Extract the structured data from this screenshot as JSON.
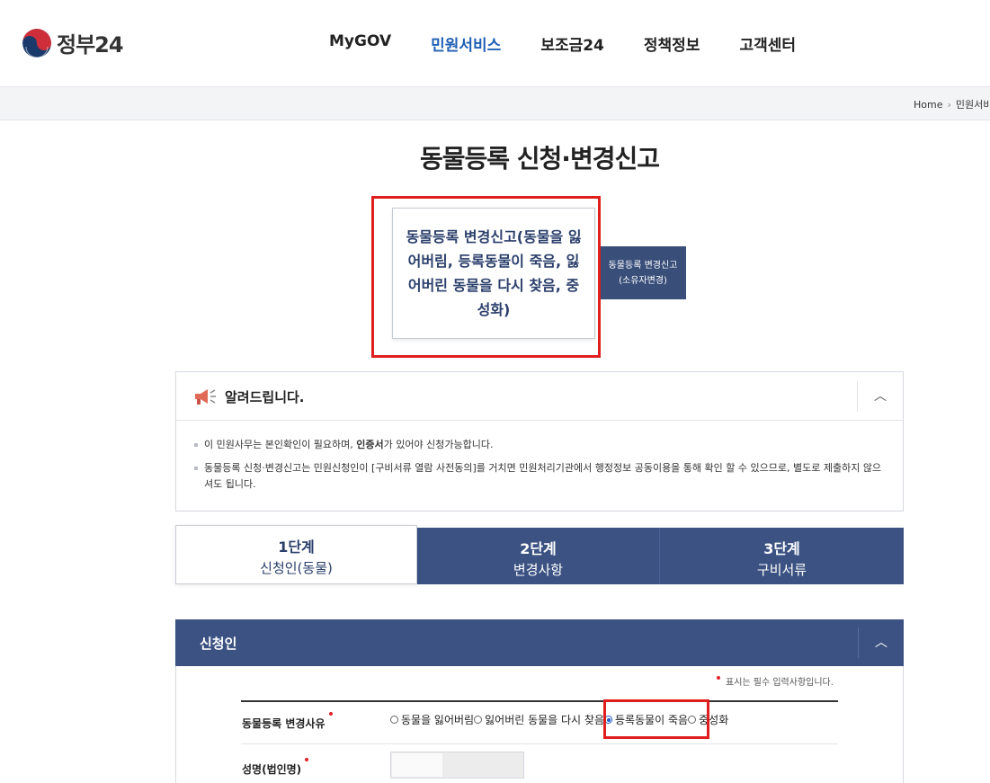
{
  "header": {
    "logo_text": "정부24",
    "nav": [
      {
        "label": "MyGOV",
        "active": false
      },
      {
        "label": "민원서비스",
        "active": true
      },
      {
        "label": "보조금24",
        "active": false
      },
      {
        "label": "정책정보",
        "active": false
      },
      {
        "label": "고객센터",
        "active": false
      }
    ]
  },
  "breadcrumb": {
    "home": "Home",
    "current": "민원서비"
  },
  "page_title": "동물등록 신청·변경신고",
  "service_types": [
    {
      "label": "동물등록 변경신고(동물을 잃어버림, 등록동물이 죽음, 잃어버린 동물을 다시 찾음, 중성화)",
      "selected": true
    },
    {
      "label": "동물등록 변경신고(소유자변경)",
      "selected": false
    }
  ],
  "notice": {
    "title": "알려드립니다.",
    "line1_a": "이 민원사무는 본인확인이 필요하며, ",
    "line1_bold": "인증서",
    "line1_b": "가 있어야 신청가능합니다.",
    "line2": "동물등록 신청·변경신고는 민원신청인이 [구비서류 열람 사전동의]를 거치면 민원처리기관에서 행정정보 공동이용을 통해 확인 할 수 있으므로, 별도로 제출하지 않으셔도 됩니다."
  },
  "steps": [
    {
      "num": "1단계",
      "label": "신청인(동물)",
      "active": true
    },
    {
      "num": "2단계",
      "label": "변경사항",
      "active": false
    },
    {
      "num": "3단계",
      "label": "구비서류",
      "active": false
    }
  ],
  "section": {
    "title": "신청인",
    "required_note": "표시는 필수 입력사항입니다.",
    "reason_label": "동물등록 변경사유",
    "reason_options": [
      {
        "label": "동물을 잃어버림",
        "checked": false
      },
      {
        "label": "잃어버린 동물을 다시 찾음",
        "checked": false
      },
      {
        "label": "등록동물이 죽음",
        "checked": true
      },
      {
        "label": "중성화",
        "checked": false
      }
    ],
    "name_label": "성명(법인명)",
    "name_value": ""
  },
  "colors": {
    "brand_navy": "#3b5282",
    "accent_blue": "#1f5fb5",
    "highlight_red": "#e01e1e"
  }
}
